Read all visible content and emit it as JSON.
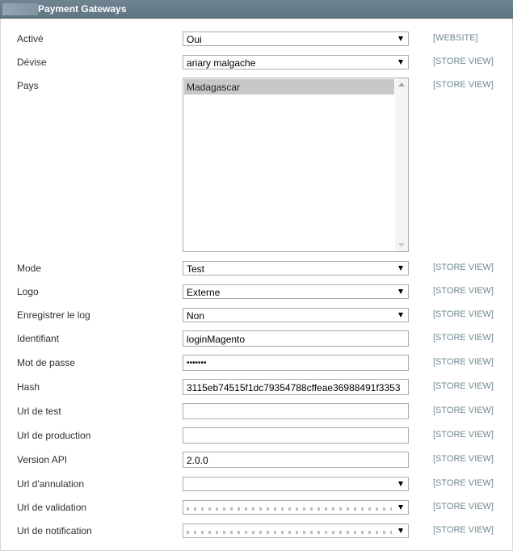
{
  "header": {
    "title": "Payment Gateways"
  },
  "fields": [
    {
      "label": "Activé",
      "value": "Oui",
      "scope": "[WEBSITE]"
    },
    {
      "label": "Dévise",
      "value": "ariary malgache",
      "scope": "[STORE VIEW]"
    },
    {
      "label": "Pays",
      "value": "Madagascar",
      "scope": "[STORE VIEW]"
    },
    {
      "label": "Mode",
      "value": "Test",
      "scope": "[STORE VIEW]"
    },
    {
      "label": "Logo",
      "value": "Externe",
      "scope": "[STORE VIEW]"
    },
    {
      "label": "Enregistrer le log",
      "value": "Non",
      "scope": "[STORE VIEW]"
    },
    {
      "label": "Identifiant",
      "value": "loginMagento",
      "scope": "[STORE VIEW]"
    },
    {
      "label": "Mot de passe",
      "value": "•••••••",
      "scope": "[STORE VIEW]"
    },
    {
      "label": "Hash",
      "value": "3115eb74515f1dc79354788cffeae36988491f3353",
      "scope": "[STORE VIEW]"
    },
    {
      "label": "Url de test",
      "value": "",
      "scope": "[STORE VIEW]"
    },
    {
      "label": "Url de production",
      "value": "",
      "scope": "[STORE VIEW]"
    },
    {
      "label": "Version API",
      "value": "2.0.0",
      "scope": "[STORE VIEW]"
    },
    {
      "label": "Url d'annulation",
      "value": "",
      "scope": "[STORE VIEW]"
    },
    {
      "label": "Url de validation",
      "value": "",
      "scope": "[STORE VIEW]"
    },
    {
      "label": "Url de notification",
      "value": "",
      "scope": "[STORE VIEW]"
    }
  ],
  "icons": {
    "dropdown": "chevron-down-icon",
    "scroll_up": "scroll-up-icon",
    "scroll_down": "scroll-down-icon"
  },
  "colors": {
    "header_bg": "#667c89",
    "scope_text": "#6f8992",
    "selected_option_bg": "#c8c8c8"
  }
}
